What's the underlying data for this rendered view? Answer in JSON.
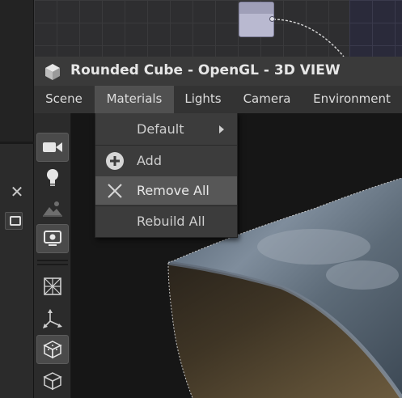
{
  "window": {
    "title": "Rounded Cube - OpenGL - 3D VIEW"
  },
  "menubar": {
    "items": [
      {
        "label": "Scene"
      },
      {
        "label": "Materials"
      },
      {
        "label": "Lights"
      },
      {
        "label": "Camera"
      },
      {
        "label": "Environment"
      }
    ]
  },
  "materials_menu": {
    "items": [
      {
        "label": "Default",
        "has_submenu": true,
        "icon": "chevron-right-icon"
      },
      {
        "label": "Add",
        "icon": "plus-circle-icon"
      },
      {
        "label": "Remove All",
        "icon": "close-icon",
        "highlighted": true
      },
      {
        "label": "Rebuild All"
      }
    ]
  },
  "toolbar": {
    "buttons": [
      {
        "icon": "camera-icon"
      },
      {
        "icon": "lightbulb-icon"
      },
      {
        "icon": "environment-icon"
      },
      {
        "icon": "display-settings-icon"
      },
      {
        "icon": "wireframe-sphere-icon"
      },
      {
        "icon": "axes-icon"
      },
      {
        "icon": "shaded-cube-icon"
      },
      {
        "icon": "wireframe-cube-icon"
      }
    ]
  },
  "colors": {
    "titlebar": "#3a3a3a",
    "menu_active": "#505050",
    "dropdown_bg": "#3c3c3c",
    "dropdown_hover": "#575757"
  }
}
